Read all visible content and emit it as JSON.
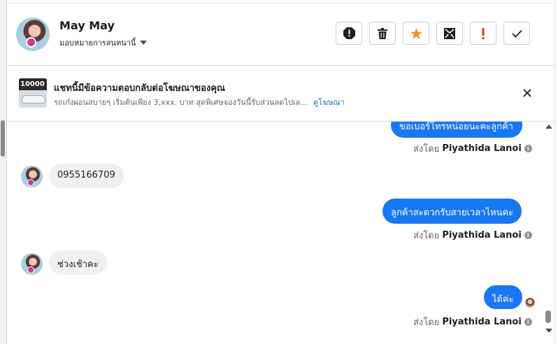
{
  "header": {
    "name": "May May",
    "assign_label": "มอบหมายการสนทนานี้",
    "actions": [
      "mark-spam",
      "delete",
      "star",
      "move-to-inbox",
      "important",
      "mark-done"
    ]
  },
  "ad_banner": {
    "thumb_text": "10000",
    "title": "แชทนี้มีข้อความตอบกลับต่อโฆษณาของคุณ",
    "description": "รถเก๋งผ่อนสบายๆ เริ่มต้นเพียง 3,xxx. บาท สุดพิเศษจองวันนี้รับส่วนลดไปเล...",
    "link": "ดูโฆษณา"
  },
  "messages": [
    {
      "dir": "out",
      "text": "ขอเบอร์โทรหน่อยนะคะลูกค้า",
      "sent_by_prefix": "ส่งโดย",
      "sent_by": "Piyathida Lanoi"
    },
    {
      "dir": "in",
      "text": "0955166709"
    },
    {
      "dir": "out",
      "text": "ลูกค้าสะดวกรับสายเวลาไหนคะ",
      "sent_by_prefix": "ส่งโดย",
      "sent_by": "Piyathida Lanoi"
    },
    {
      "dir": "in",
      "text": "ช่วงเช้าคะ"
    },
    {
      "dir": "out",
      "text": "ได้ค่ะ",
      "sent_by_prefix": "ส่งโดย",
      "sent_by": "Piyathida Lanoi"
    }
  ],
  "colors": {
    "outgoing_bubble": "#1877f2",
    "incoming_bubble": "#f0f0f0",
    "star": "#f5922b",
    "important": "#e0342b",
    "link": "#1a73a8"
  }
}
